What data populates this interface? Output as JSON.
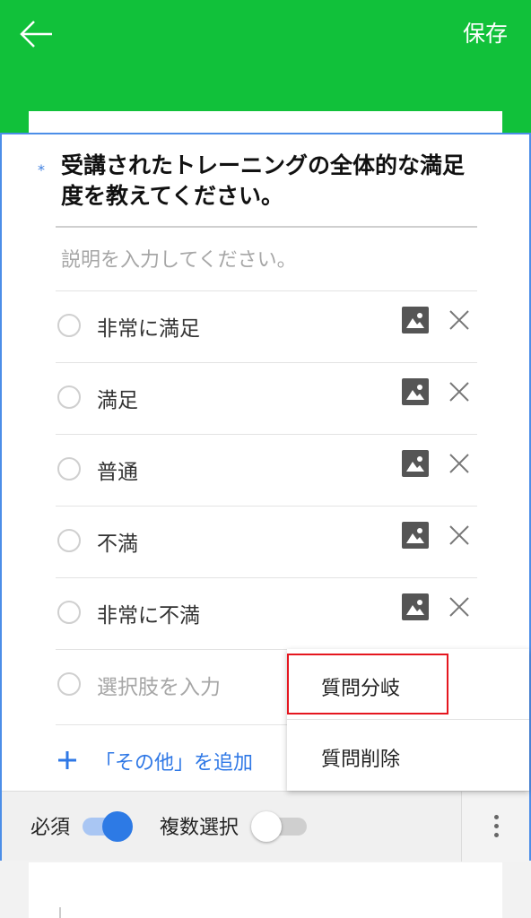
{
  "header": {
    "back_icon": "arrow-left-icon",
    "save_label": "保存",
    "color": "#11c13a"
  },
  "question": {
    "required_marker": "*",
    "title": "受講されたトレーニングの全体的な満足度を教えてください。",
    "description_placeholder": "説明を入力してください。"
  },
  "options": [
    {
      "label": "非常に満足"
    },
    {
      "label": "満足"
    },
    {
      "label": "普通"
    },
    {
      "label": "不満"
    },
    {
      "label": "非常に不満"
    }
  ],
  "new_option_placeholder": "選択肢を入力",
  "add_other_label": "「その他」を追加",
  "bottom_bar": {
    "required_label": "必須",
    "required_on": true,
    "multi_label": "複数選択",
    "multi_on": false
  },
  "menu": {
    "items": [
      {
        "label": "質問分岐"
      },
      {
        "label": "質問削除"
      }
    ]
  },
  "colors": {
    "accent": "#2d7ae5",
    "highlight": "#e5161f"
  }
}
